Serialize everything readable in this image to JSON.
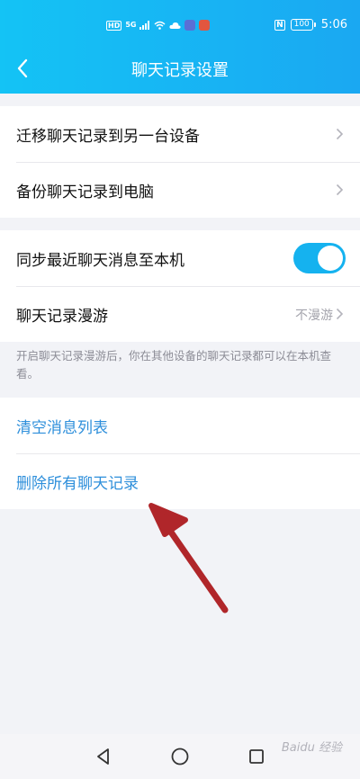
{
  "status_bar": {
    "hd_badge": "HD",
    "net_label": "5G",
    "nfc_label": "N",
    "battery": "100",
    "time": "5:06"
  },
  "header": {
    "title": "聊天记录设置"
  },
  "group1": {
    "items": [
      {
        "label": "迁移聊天记录到另一台设备"
      },
      {
        "label": "备份聊天记录到电脑"
      }
    ]
  },
  "group2": {
    "sync_label": "同步最近聊天消息至本机",
    "sync_enabled": true,
    "roam_label": "聊天记录漫游",
    "roam_value": "不漫游",
    "note": "开启聊天记录漫游后，你在其他设备的聊天记录都可以在本机查看。"
  },
  "group3": {
    "clear_label": "清空消息列表",
    "delete_label": "删除所有聊天记录"
  },
  "colors": {
    "header": "#14c3f5",
    "accent_blue": "#2e8fdb",
    "toggle_on": "#15b2ef",
    "annotation_arrow": "#b0262a"
  },
  "watermark": "Baidu 经验"
}
